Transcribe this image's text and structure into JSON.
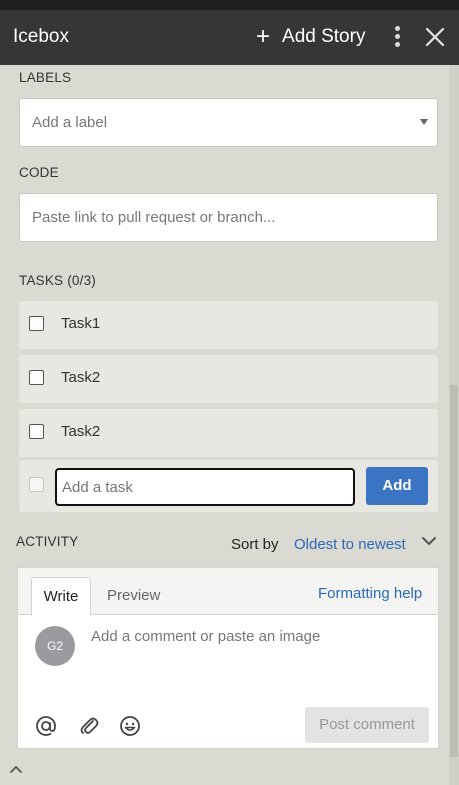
{
  "header": {
    "title": "Icebox",
    "add_story_label": "Add Story",
    "icons": [
      "plus-icon",
      "kebab-menu-icon",
      "close-icon"
    ]
  },
  "labels": {
    "heading": "LABELS",
    "placeholder": "Add a label"
  },
  "code": {
    "heading": "CODE",
    "placeholder": "Paste link to pull request or branch..."
  },
  "tasks": {
    "heading": "TASKS (0/3)",
    "items": [
      {
        "label": "Task1",
        "done": false
      },
      {
        "label": "Task2",
        "done": false
      },
      {
        "label": "Task2",
        "done": false
      }
    ],
    "new_task_placeholder": "Add a task",
    "add_label": "Add"
  },
  "activity": {
    "heading": "ACTIVITY",
    "sort_by_label": "Sort by",
    "sort_value": "Oldest to newest"
  },
  "comment": {
    "tab_write": "Write",
    "tab_preview": "Preview",
    "formatting_help": "Formatting help",
    "avatar_initials": "G2",
    "placeholder": "Add a comment or paste an image",
    "post_label": "Post comment",
    "tool_icons": [
      "at-mention-icon",
      "attachment-icon",
      "emoji-icon"
    ]
  },
  "colors": {
    "header_bg": "#363636",
    "panel_bg": "#dad9d2",
    "task_bg": "#e8e7e1",
    "accent_blue": "#3b74c2",
    "link_blue": "#2a6ab8"
  }
}
